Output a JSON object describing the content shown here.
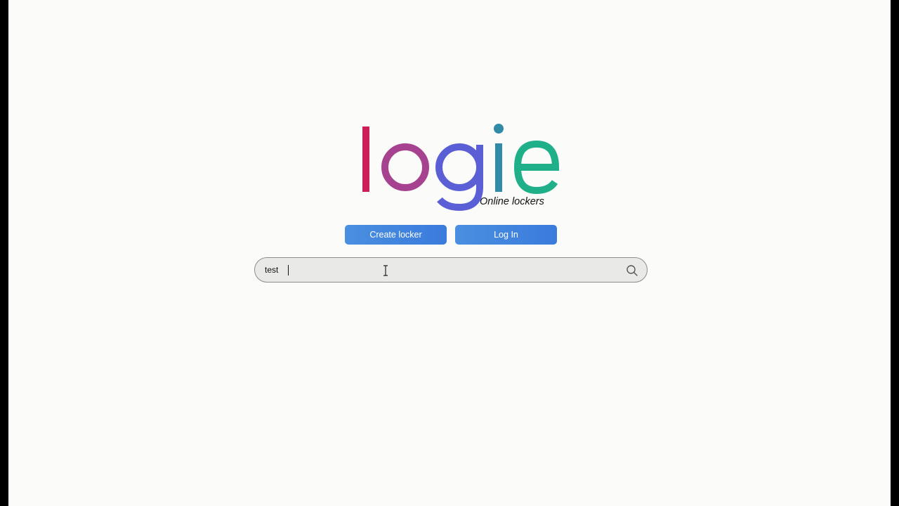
{
  "brand": {
    "name": "logie",
    "letters": [
      "l",
      "o",
      "g",
      "i",
      "e"
    ],
    "tagline": "Online lockers",
    "colors": {
      "l": "#cc1f5a",
      "o": "#a6428f",
      "g": "#5a5fd6",
      "i": "#2f8ba8",
      "e": "#1fb089"
    }
  },
  "actions": {
    "create_label": "Create locker",
    "login_label": "Log In",
    "button_color": "#3f84de"
  },
  "search": {
    "value": "test",
    "icon": "search-icon"
  },
  "cursor": {
    "icon": "text-cursor-icon"
  }
}
